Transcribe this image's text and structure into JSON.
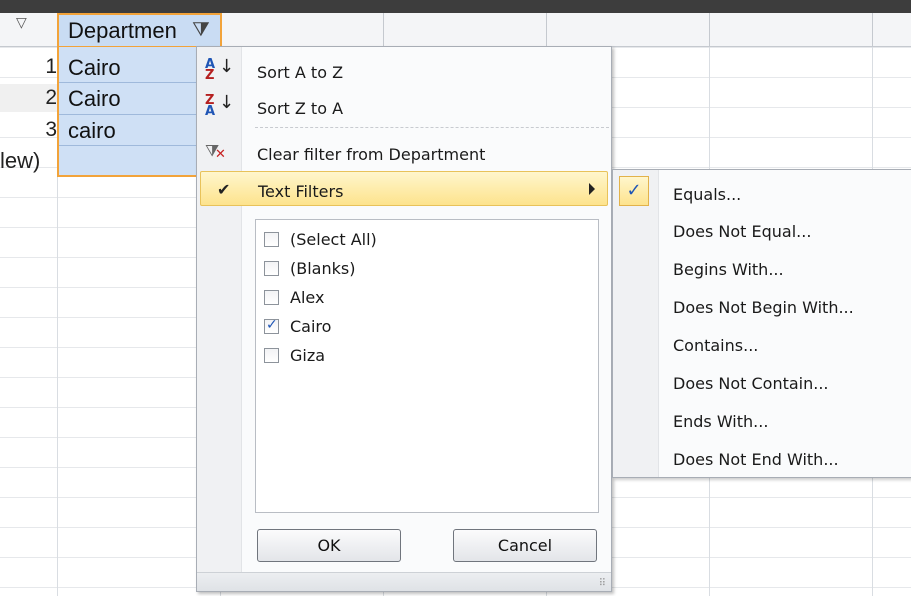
{
  "column_header": {
    "label": "Departmen",
    "filter_icon": "funnel-filter-icon",
    "dropdown_icon": "triangle-down-icon"
  },
  "rows": [
    {
      "number": "1",
      "value": "Cairo"
    },
    {
      "number": "2",
      "value": "Cairo"
    },
    {
      "number": "3",
      "value": "cairo"
    }
  ],
  "new_row_label": "lew)",
  "menu": {
    "sort_asc": {
      "label": "Sort A to Z",
      "icon": "sort-a-to-z-icon"
    },
    "sort_desc": {
      "label": "Sort Z to A",
      "icon": "sort-z-to-a-icon"
    },
    "clear_filter": {
      "label": "Clear filter from Department",
      "icon": "clear-filter-icon"
    },
    "text_filters": {
      "label": "Text Filters",
      "checkmark": "✔"
    },
    "list": [
      {
        "label": "(Select All)",
        "checked": false
      },
      {
        "label": "(Blanks)",
        "checked": false
      },
      {
        "label": "Alex",
        "checked": false
      },
      {
        "label": "Cairo",
        "checked": true
      },
      {
        "label": "Giza",
        "checked": false
      }
    ],
    "ok_label": "OK",
    "cancel_label": "Cancel"
  },
  "submenu": {
    "items": [
      "Equals...",
      "Does Not Equal...",
      "Begins With...",
      "Does Not Begin With...",
      "Contains...",
      "Does Not Contain...",
      "Ends With...",
      "Does Not End With..."
    ],
    "checked_mark": "✓"
  },
  "colors": {
    "selection_border": "#f2a33a",
    "selection_fill": "#cfe0f5",
    "highlight": "#fde38d",
    "accent_blue": "#1f55b5"
  }
}
